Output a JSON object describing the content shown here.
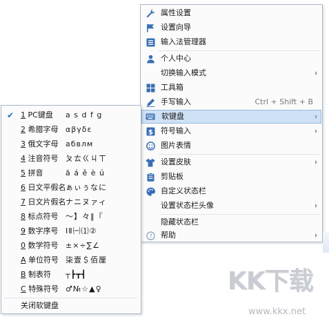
{
  "main_menu": {
    "items": [
      {
        "label": "属性设置",
        "icon": "wrench-icon",
        "has_submenu": false,
        "shortcut": ""
      },
      {
        "label": "设置向导",
        "icon": "flag-icon",
        "has_submenu": false,
        "shortcut": ""
      },
      {
        "label": "输入法管理器",
        "icon": "list-icon",
        "has_submenu": false,
        "shortcut": ""
      },
      {
        "label": "个人中心",
        "icon": "person-icon",
        "has_submenu": false,
        "shortcut": ""
      },
      {
        "label": "切换输入模式",
        "icon": "",
        "has_submenu": true,
        "shortcut": ""
      },
      {
        "label": "工具箱",
        "icon": "grid-icon",
        "has_submenu": false,
        "shortcut": ""
      },
      {
        "label": "手写输入",
        "icon": "pen-icon",
        "has_submenu": false,
        "shortcut": "Ctrl + Shift + B"
      },
      {
        "label": "软键盘",
        "icon": "keyboard-icon",
        "has_submenu": true,
        "shortcut": "",
        "highlighted": true
      },
      {
        "label": "符号输入",
        "icon": "dollar-icon",
        "has_submenu": true,
        "shortcut": ""
      },
      {
        "label": "图片表情",
        "icon": "smiley-icon",
        "has_submenu": false,
        "shortcut": ""
      },
      {
        "label": "设置皮肤",
        "icon": "shirt-icon",
        "has_submenu": true,
        "shortcut": ""
      },
      {
        "label": "剪贴板",
        "icon": "clipboard-icon",
        "has_submenu": false,
        "shortcut": ""
      },
      {
        "label": "自定义状态栏",
        "icon": "palette-icon",
        "has_submenu": false,
        "shortcut": ""
      },
      {
        "label": "设置状态栏头像",
        "icon": "",
        "has_submenu": true,
        "shortcut": ""
      },
      {
        "label": "隐藏状态栏",
        "icon": "",
        "has_submenu": false,
        "shortcut": ""
      },
      {
        "label": "帮助",
        "icon": "help-icon",
        "has_submenu": true,
        "shortcut": ""
      }
    ]
  },
  "keyboard_menu": {
    "items": [
      {
        "key": "1",
        "name": "PC键盘",
        "preview": "a s d f g",
        "checked": true
      },
      {
        "key": "2",
        "name": "希腊字母",
        "preview": "αβγδε",
        "checked": false
      },
      {
        "key": "3",
        "name": "俄文字母",
        "preview": "абвлм",
        "checked": false
      },
      {
        "key": "4",
        "name": "注音符号",
        "preview": "ㄆㄊㄍㄐㄒ",
        "checked": false
      },
      {
        "key": "5",
        "name": "拼音",
        "preview": "ā á ě è ú",
        "checked": false
      },
      {
        "key": "6",
        "name": "日文平假名",
        "preview": "ぁぃぅなに",
        "checked": false
      },
      {
        "key": "7",
        "name": "日文片假名",
        "preview": "ナニヌァィ",
        "checked": false
      },
      {
        "key": "8",
        "name": "标点符号",
        "preview": "～】々‖『",
        "checked": false
      },
      {
        "key": "9",
        "name": "数字序号",
        "preview": "ⅠⅡ㈠⑴②",
        "checked": false
      },
      {
        "key": "0",
        "name": "数学符号",
        "preview": "±×÷∑∠",
        "checked": false
      },
      {
        "key": "A",
        "name": "单位符号",
        "preview": "柒壹＄佰厘",
        "checked": false
      },
      {
        "key": "B",
        "name": "制表符",
        "preview": "┬┣┳┫",
        "checked": false
      },
      {
        "key": "C",
        "name": "特殊符号",
        "preview": "♂№☆▲♀",
        "checked": false
      }
    ],
    "close_label": "关闭软键盘"
  },
  "watermark": {
    "logo": "KK下载",
    "url": "www.kkx.net"
  },
  "colors": {
    "icon_blue": "#3a6fb4",
    "highlight_bg": "#cfe1f6",
    "highlight_border": "#97b8de",
    "check": "#2b6fc1"
  }
}
